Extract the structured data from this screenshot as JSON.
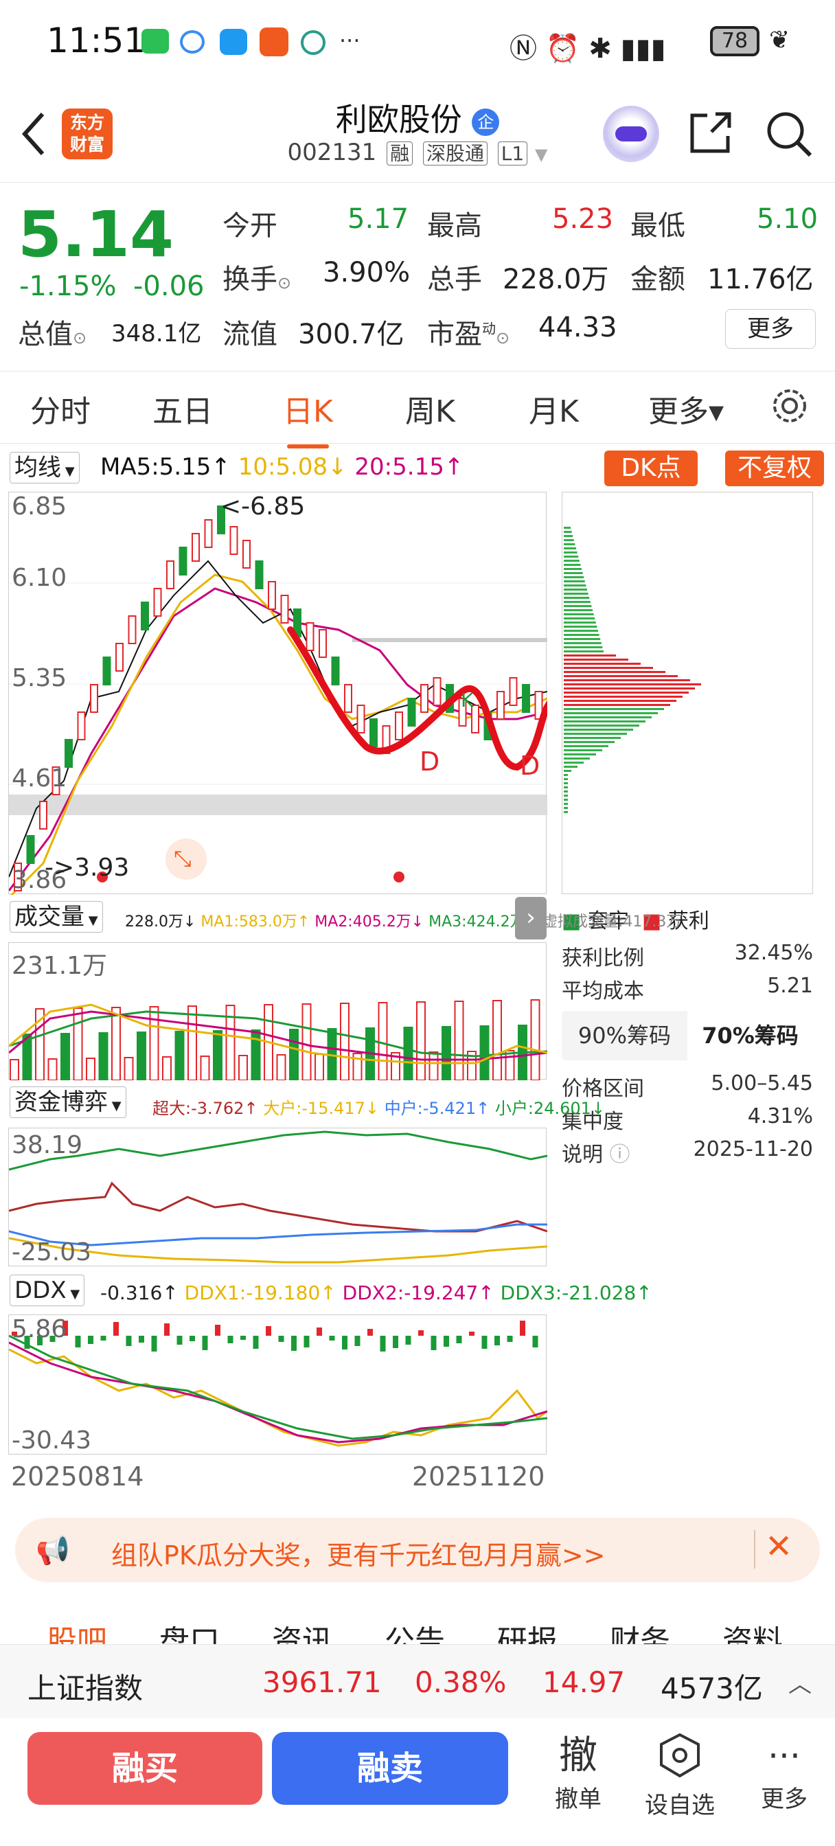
{
  "status_bar": {
    "time": "11:51",
    "battery": "78",
    "dots": "···"
  },
  "header": {
    "title": "利欧股份",
    "title_badge": "企",
    "code": "002131",
    "tags": [
      "融",
      "深股通",
      "L1"
    ],
    "logo_line1": "东方",
    "logo_line2": "财富"
  },
  "quote": {
    "price": "5.14",
    "change_pct": "-1.15%",
    "change": "-0.06",
    "open_label": "今开",
    "open": "5.17",
    "high_label": "最高",
    "high": "5.23",
    "low_label": "最低",
    "low": "5.10",
    "turnover_label": "换手",
    "turnover": "3.90%",
    "volume_label": "总手",
    "volume": "228.0万",
    "amount_label": "金额",
    "amount": "11.76亿",
    "mktcap_label": "总值",
    "mktcap": "348.1亿",
    "float_label": "流值",
    "float": "300.7亿",
    "pe_label": "市盈",
    "pe_sup": "动",
    "pe": "44.33",
    "more": "更多"
  },
  "period_tabs": [
    "分时",
    "五日",
    "日K",
    "周K",
    "月K",
    "更多▾"
  ],
  "active_tab": "日K",
  "kline": {
    "indicator": "均线",
    "ma5": "MA5:5.15↑",
    "ma10": "10:5.08↓",
    "ma20": "20:5.15↑",
    "dk_button": "DK点",
    "fq_button": "不复权",
    "y_labels": [
      "6.85",
      "6.10",
      "5.35",
      "4.61",
      "3.86"
    ],
    "high_mark": "<-6.85",
    "low_mark": "->3.93",
    "annot_d1": "D",
    "annot_d2": "D",
    "annot_k": "K"
  },
  "volume_panel": {
    "indicator": "成交量",
    "values": "228.0万↓",
    "ma1": "MA1:583.0万↑",
    "ma2": "MA2:405.2万↓",
    "ma3": "MA3:424.2万↓",
    "virtual": "虚拟成交量:417.3万",
    "y_label": "231.1万"
  },
  "fund_panel": {
    "indicator": "资金博弈",
    "super": "超大:-3.762↑",
    "large": "大户:-15.417↓",
    "mid": "中户:-5.421↑",
    "small": "小户:24.601↓",
    "y_top": "38.19",
    "y_bottom": "-25.03"
  },
  "ddx_panel": {
    "indicator": "DDX",
    "ddx": "-0.316↑",
    "ddx1": "DDX1:-19.180↑",
    "ddx2": "DDX2:-19.247↑",
    "ddx3": "DDX3:-21.028↑",
    "y_top": "5.86",
    "y_bottom": "-30.43",
    "date_start": "20250814",
    "date_end": "20251120"
  },
  "chips": {
    "legend_lock": "套牢",
    "legend_profit": "获利",
    "rows": [
      {
        "label": "获利比例",
        "value": "32.45%"
      },
      {
        "label": "平均成本",
        "value": "5.21"
      },
      {
        "label": "价格区间",
        "value": "5.00–5.45"
      },
      {
        "label": "集中度",
        "value": "4.31%"
      },
      {
        "label": "说明",
        "value": "2025-11-20"
      }
    ],
    "tab90": "90%筹码",
    "tab70": "70%筹码"
  },
  "banner": {
    "text": "组队PK瓜分大奖，更有千元红包月月赢>>"
  },
  "bottom_tabs": [
    "股吧",
    "盘口",
    "资讯",
    "公告",
    "研报",
    "财务",
    "资料"
  ],
  "index_bar": {
    "name": "上证指数",
    "price": "3961.71",
    "pct": "0.38%",
    "change": "14.97",
    "amount": "4573亿"
  },
  "actions": {
    "buy": "融买",
    "sell": "融卖",
    "cancel_icon": "撤",
    "cancel": "撤单",
    "watch": "设自选",
    "more": "更多"
  },
  "colors": {
    "up": "#e2262b",
    "down": "#1a9a36",
    "accent": "#f05a1e",
    "buy": "#ee5a5a",
    "sell": "#3b6ef0"
  }
}
